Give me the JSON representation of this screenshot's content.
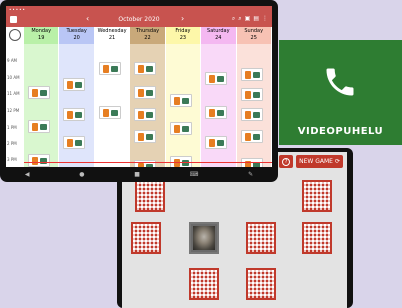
{
  "video_call": {
    "label": "VIDEOPUHELU",
    "bg_color": "#2e7d32"
  },
  "calendar": {
    "month_title": "October 2020",
    "prev_arrow": "‹",
    "next_arrow": "›",
    "days": [
      {
        "name": "Monday",
        "date": "19",
        "color": "#b9f0a8"
      },
      {
        "name": "Tuesday",
        "date": "20",
        "color": "#b9c6f5"
      },
      {
        "name": "Wednesday",
        "date": "21",
        "color": "#ffffff"
      },
      {
        "name": "Thursday",
        "date": "22",
        "color": "#c9a97a"
      },
      {
        "name": "Friday",
        "date": "23",
        "color": "#fdf7a9"
      },
      {
        "name": "Saturday",
        "date": "24",
        "color": "#f4b8f1"
      },
      {
        "name": "Sunday",
        "date": "25",
        "color": "#f7c2b4"
      }
    ],
    "times": [
      "9 AM",
      "10 AM",
      "11 AM",
      "12 PM",
      "1 PM",
      "2 PM",
      "3 PM"
    ],
    "icons": [
      "person-icon",
      "search-icon",
      "zoom-out-icon",
      "calendar-icon",
      "calendar-day-icon",
      "more-icon"
    ],
    "accent_color": "#c8534f"
  },
  "memory_game": {
    "help_label": "?",
    "new_game_label": "NEW GAME",
    "icons": [
      "restart-icon",
      "help-icon",
      "refresh-icon"
    ],
    "card_back_color": "#c0392b"
  }
}
